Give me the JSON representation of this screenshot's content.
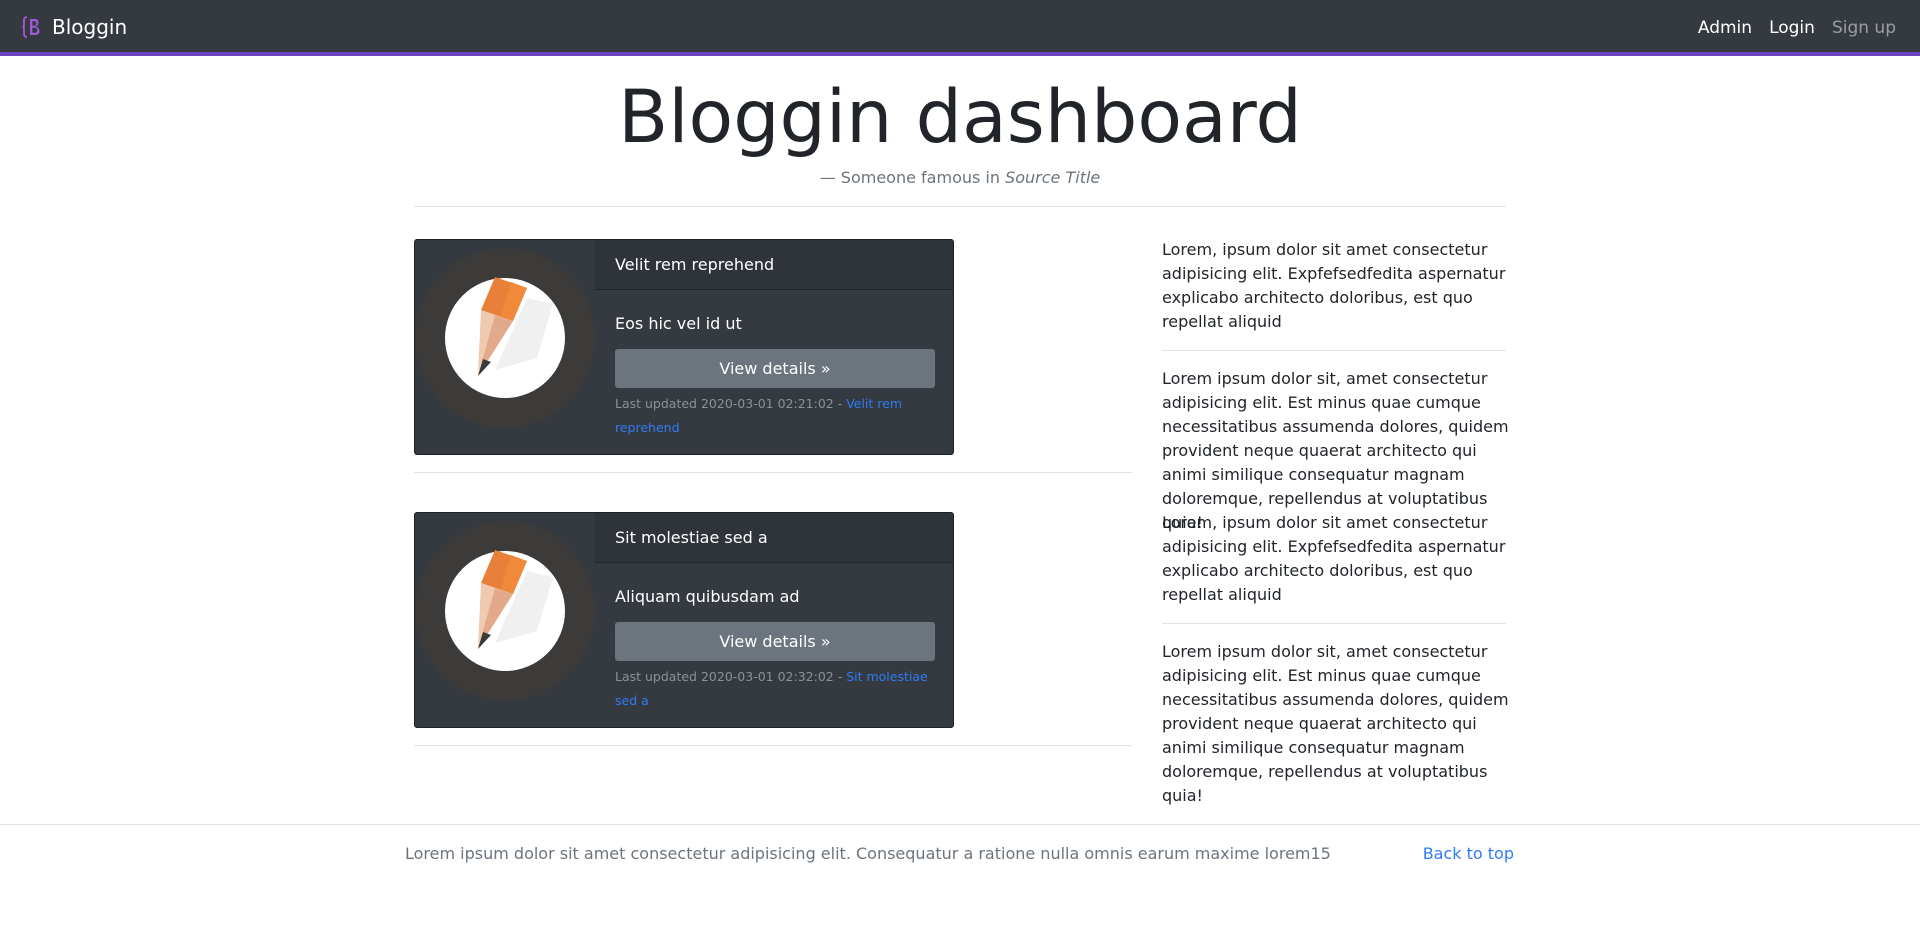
{
  "navbar": {
    "brand": "Bloggin",
    "links": [
      {
        "label": "Admin"
      },
      {
        "label": "Login"
      },
      {
        "label": "Sign up"
      }
    ]
  },
  "header": {
    "title": "Bloggin dashboard",
    "attribution_prefix": "— Someone famous in ",
    "attribution_source": "Source Title"
  },
  "posts": [
    {
      "title": "Velit rem reprehend",
      "subtitle": "Eos hic vel id ut",
      "button": "View details »",
      "updated_prefix": "Last updated 2020-03-01 02:21:02 - ",
      "link": "Velit rem reprehend",
      "icon": "pencil-icon"
    },
    {
      "title": "Sit molestiae sed a",
      "subtitle": "Aliquam quibusdam ad",
      "button": "View details »",
      "updated_prefix": "Last updated 2020-03-01 02:32:02 - ",
      "link": "Sit molestiae sed a",
      "icon": "pencil-icon"
    }
  ],
  "sidebar": {
    "paragraphs": [
      "Lorem, ipsum dolor sit amet consectetur adipisicing elit. Expfefsedfedita aspernatur explicabo architecto doloribus, est quo repellat aliquid",
      "Lorem ipsum dolor sit, amet consectetur adipisicing elit. Est minus quae cumque necessitatibus assumenda dolores, quidem provident neque quaerat architecto qui animi similique consequatur magnam doloremque, repellendus at voluptatibus quia!",
      "Lorem, ipsum dolor sit amet consectetur adipisicing elit. Expfefsedfedita aspernatur explicabo architecto doloribus, est quo repellat aliquid",
      "Lorem ipsum dolor sit, amet consectetur adipisicing elit. Est minus quae cumque necessitatibus assumenda dolores, quidem provident neque quaerat architecto qui animi similique consequatur magnam doloremque, repellendus at voluptatibus quia!"
    ]
  },
  "footer": {
    "text": "Lorem ipsum dolor sit amet consectetur adipisicing elit. Consequatur a ratione nulla omnis earum maxime lorem15",
    "back_to_top": "Back to top"
  },
  "colors": {
    "navbar_bg": "#343a40",
    "accent": "#6f42c1",
    "card_bg": "#343a40",
    "button_bg": "#6c757d",
    "link": "#2f7bf5"
  }
}
